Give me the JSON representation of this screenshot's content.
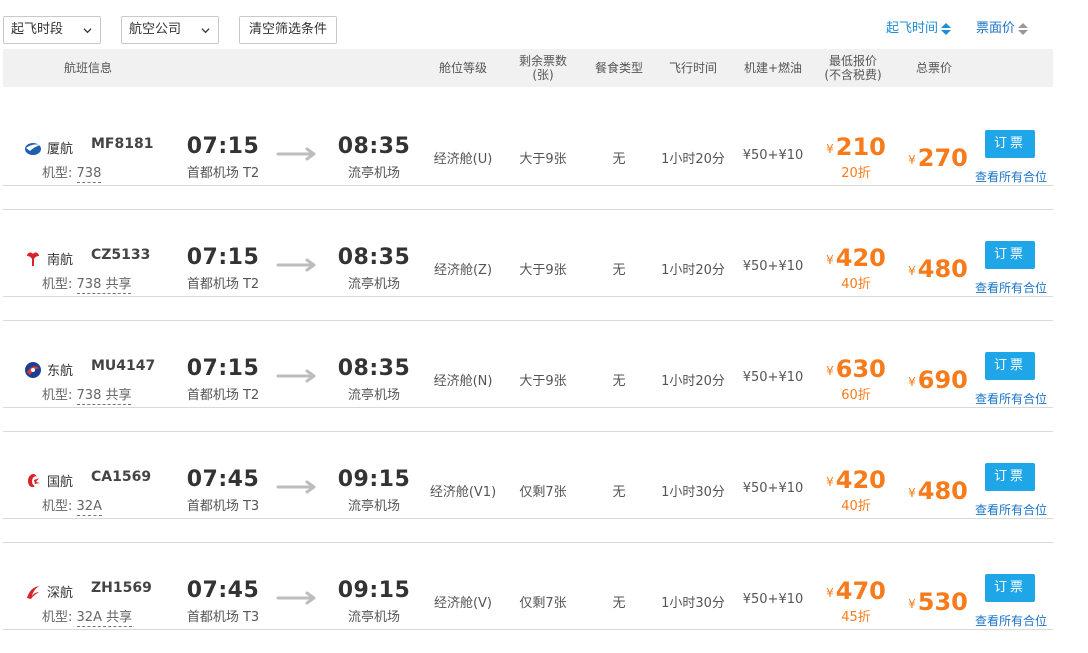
{
  "filters": {
    "time_select": "起飞时段",
    "airline_select": "航空公司",
    "clear_label": "清空筛选条件",
    "sort_departure": "起飞时间",
    "sort_price": "票面价"
  },
  "columns": {
    "flight_info": "航班信息",
    "cabin": "舱位等级",
    "seats_line1": "剩余票数",
    "seats_line2": "(张)",
    "meal": "餐食类型",
    "duration": "飞行时间",
    "tax": "机建+燃油",
    "lowest_line1": "最低报价",
    "lowest_line2": "(不含税费)",
    "total": "总票价"
  },
  "labels": {
    "plane_prefix": "机型:",
    "yen": "¥",
    "book": "订票",
    "all_cabins": "查看所有合位"
  },
  "colors": {
    "accent_blue": "#1a8ed6",
    "book_button": "#1ea6e8",
    "price_orange": "#f77b1a"
  },
  "flights": [
    {
      "logo": "xiamen-airlines-logo-icon",
      "airline": "厦航",
      "flight_no": "MF8181",
      "plane_model": "738",
      "shared": "",
      "dep_time": "07:15",
      "dep_airport": "首都机场 T2",
      "arr_time": "08:35",
      "arr_airport": "流亭机场",
      "cabin": "经济舱(U)",
      "seats": "大于9张",
      "meal": "无",
      "duration": "1小时20分",
      "tax": "¥50+¥10",
      "lowest_price": "210",
      "discount": "20折",
      "total_price": "270"
    },
    {
      "logo": "china-southern-logo-icon",
      "airline": "南航",
      "flight_no": "CZ5133",
      "plane_model": "738 共享",
      "shared": "",
      "dep_time": "07:15",
      "dep_airport": "首都机场 T2",
      "arr_time": "08:35",
      "arr_airport": "流亭机场",
      "cabin": "经济舱(Z)",
      "seats": "大于9张",
      "meal": "无",
      "duration": "1小时20分",
      "tax": "¥50+¥10",
      "lowest_price": "420",
      "discount": "40折",
      "total_price": "480"
    },
    {
      "logo": "china-eastern-logo-icon",
      "airline": "东航",
      "flight_no": "MU4147",
      "plane_model": "738 共享",
      "shared": "",
      "dep_time": "07:15",
      "dep_airport": "首都机场 T2",
      "arr_time": "08:35",
      "arr_airport": "流亭机场",
      "cabin": "经济舱(N)",
      "seats": "大于9张",
      "meal": "无",
      "duration": "1小时20分",
      "tax": "¥50+¥10",
      "lowest_price": "630",
      "discount": "60折",
      "total_price": "690"
    },
    {
      "logo": "air-china-logo-icon",
      "airline": "国航",
      "flight_no": "CA1569",
      "plane_model": "32A",
      "shared": "",
      "dep_time": "07:45",
      "dep_airport": "首都机场 T3",
      "arr_time": "09:15",
      "arr_airport": "流亭机场",
      "cabin": "经济舱(V1)",
      "seats": "仅剩7张",
      "meal": "无",
      "duration": "1小时30分",
      "tax": "¥50+¥10",
      "lowest_price": "420",
      "discount": "40折",
      "total_price": "480"
    },
    {
      "logo": "shenzhen-airlines-logo-icon",
      "airline": "深航",
      "flight_no": "ZH1569",
      "plane_model": "32A 共享",
      "shared": "",
      "dep_time": "07:45",
      "dep_airport": "首都机场 T3",
      "arr_time": "09:15",
      "arr_airport": "流亭机场",
      "cabin": "经济舱(V)",
      "seats": "仅剩7张",
      "meal": "无",
      "duration": "1小时30分",
      "tax": "¥50+¥10",
      "lowest_price": "470",
      "discount": "45折",
      "total_price": "530"
    }
  ]
}
